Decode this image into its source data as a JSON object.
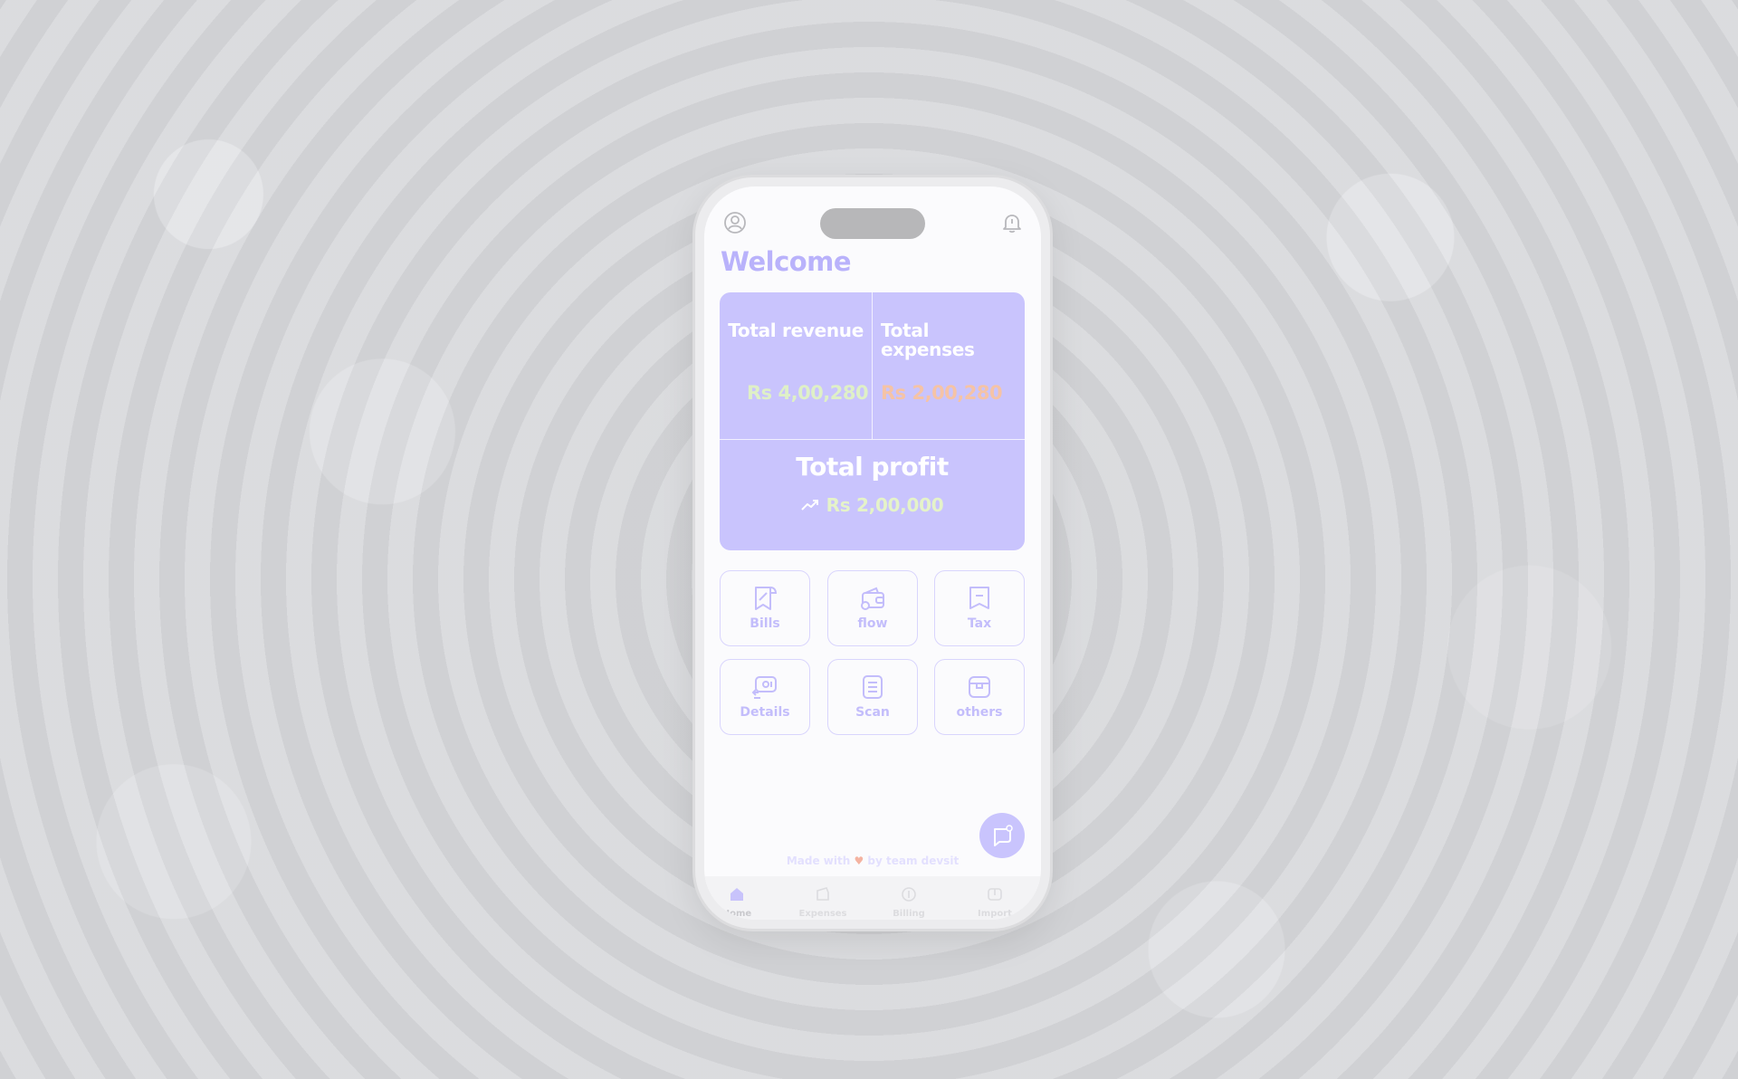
{
  "app": {
    "welcome": "Welcome"
  },
  "summary": {
    "revenue_label": "Total revenue",
    "revenue_value": "Rs 4,00,280",
    "expenses_label": "Total expenses",
    "expenses_value": "Rs 2,00,280",
    "profit_label": "Total profit",
    "profit_value": "Rs 2,00,000"
  },
  "tiles": [
    {
      "label": "Bills",
      "icon": "receipt-icon"
    },
    {
      "label": "flow",
      "icon": "wallet-icon"
    },
    {
      "label": "Tax",
      "icon": "tax-doc-icon"
    },
    {
      "label": "Details",
      "icon": "details-icon"
    },
    {
      "label": "Scan",
      "icon": "scan-doc-icon"
    },
    {
      "label": "others",
      "icon": "box-icon"
    }
  ],
  "credit": {
    "prefix": "Made with",
    "suffix": "by team devsit"
  },
  "nav": [
    {
      "label": "Home",
      "icon": "home-icon"
    },
    {
      "label": "Expenses",
      "icon": "expenses-icon"
    },
    {
      "label": "Billing",
      "icon": "billing-icon"
    },
    {
      "label": "Import",
      "icon": "import-icon"
    }
  ],
  "colors": {
    "accent": "#c9c4fd",
    "revenue": "#dff0c7",
    "expenses": "#f5c3a6",
    "title": "#b9b2fb"
  }
}
